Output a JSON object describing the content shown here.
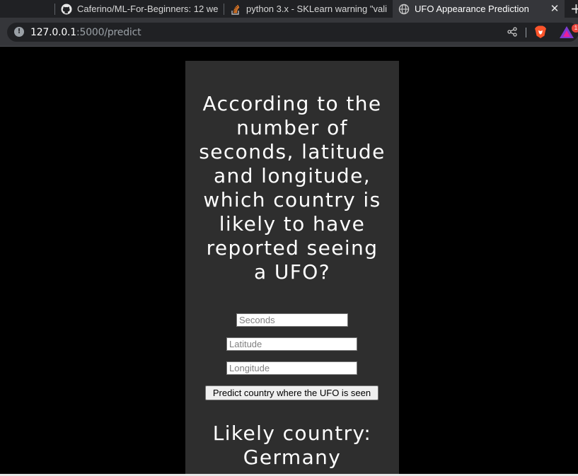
{
  "browser": {
    "tabs": [
      {
        "title": "Caferino/ML-For-Beginners: 12 we",
        "icon": "github-icon",
        "active": false
      },
      {
        "title": "python 3.x - SKLearn warning \"vali",
        "icon": "stackoverflow-icon",
        "active": false
      },
      {
        "title": "UFO Appearance Prediction",
        "icon": "globe-icon",
        "active": true
      }
    ],
    "close_glyph": "✕",
    "new_tab_glyph": "+",
    "url_host": "127.0.0.1",
    "url_rest": ":5000/predict",
    "site_info_glyph": "!",
    "rewards_badge": "1"
  },
  "page": {
    "question": "According to the number of seconds, latitude and longitude, which country is likely to have reported seeing a UFO?",
    "form": {
      "seconds_placeholder": "Seconds",
      "latitude_placeholder": "Latitude",
      "longitude_placeholder": "Longitude",
      "seconds_value": "",
      "latitude_value": "",
      "longitude_value": "",
      "submit_label": "Predict country where the UFO is seen"
    },
    "result": "Likely country: Germany"
  },
  "colors": {
    "page_background": "#000000",
    "card_background": "#2e2e2e",
    "text": "#ffffff",
    "brave_orange": "#fb542b"
  }
}
